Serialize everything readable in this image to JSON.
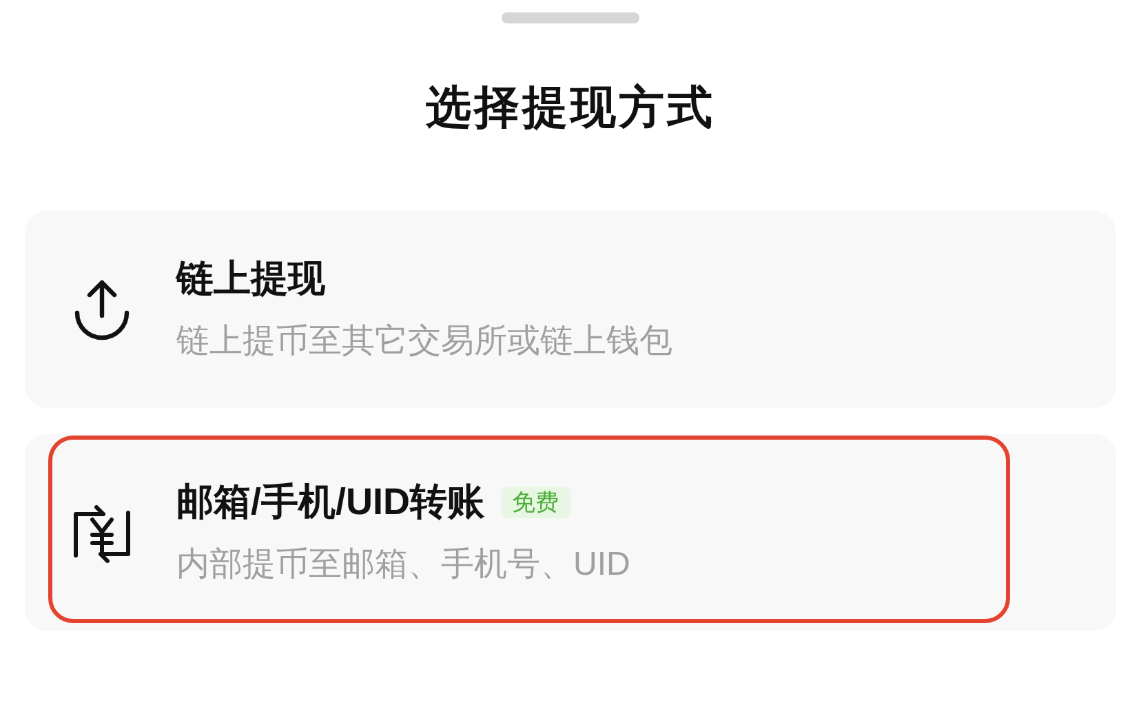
{
  "title": "选择提现方式",
  "options": [
    {
      "kind": "onchain",
      "title": "链上提现",
      "subtitle": "链上提币至其它交易所或链上钱包",
      "highlighted": false
    },
    {
      "kind": "internal",
      "title": "邮箱/手机/UID转账",
      "badge": "免费",
      "subtitle": "内部提币至邮箱、手机号、UID",
      "highlighted": true
    }
  ]
}
